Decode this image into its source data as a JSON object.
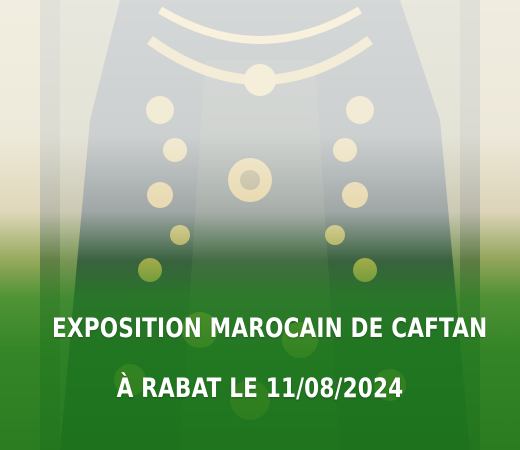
{
  "banner": {
    "title_line_1": "EXPOSITION MAROCAIN DE CAFTAN",
    "title_line_2": "À RABAT LE 11/08/2024"
  },
  "colors": {
    "overlay_green": "#1f801d",
    "overlay_white": "#ffffff",
    "text": "#ffffff",
    "embroidery_gold": "#c9a94b",
    "caftan_dark": "#2c3b3a"
  },
  "image": {
    "subject": "caftan-photo"
  }
}
